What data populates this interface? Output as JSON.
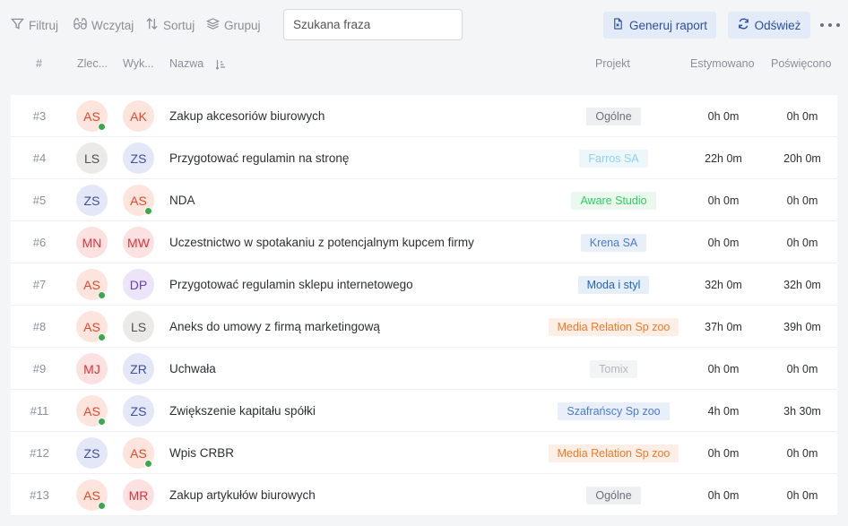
{
  "toolbar": {
    "filter_label": "Filtruj",
    "load_label": "Wczytaj",
    "sort_label": "Sortuj",
    "group_label": "Grupuj",
    "search_placeholder": "Szukana fraza",
    "report_label": "Generuj raport",
    "refresh_label": "Odśwież"
  },
  "header": {
    "num": "#",
    "ordering": "Zlec...",
    "executing": "Wyk...",
    "name": "Nazwa",
    "project": "Projekt",
    "estimated": "Estymowano",
    "spent": "Poświęcono"
  },
  "colors": {
    "online": "#3aa84b",
    "button_bg": "#e3ebf9",
    "button_text": "#2c4fa0"
  },
  "avatar_styles": {
    "AS": {
      "bg": "#fde5de",
      "fg": "#e0482a"
    },
    "AK": {
      "bg": "#fde5de",
      "fg": "#e0482a"
    },
    "LS": {
      "bg": "#eceae9",
      "fg": "#4c4f55"
    },
    "ZS": {
      "bg": "#e4e7f7",
      "fg": "#3e4da3"
    },
    "MN": {
      "bg": "#fde0e0",
      "fg": "#e0323a"
    },
    "MW": {
      "bg": "#fde0e0",
      "fg": "#e0323a"
    },
    "DP": {
      "bg": "#ece4f8",
      "fg": "#6a3fb3"
    },
    "MJ": {
      "bg": "#fde0e0",
      "fg": "#e0323a"
    },
    "ZR": {
      "bg": "#e4e7f7",
      "fg": "#3e4da3"
    },
    "MR": {
      "bg": "#fde0e0",
      "fg": "#e0323a"
    }
  },
  "rows": [
    {
      "num": "#3",
      "ordering": "AS",
      "ordering_online": true,
      "executing": "AK",
      "executing_online": false,
      "name": "Zakup akcesoriów biurowych",
      "project": "Ogólne",
      "project_bg": "#eeeff1",
      "project_fg": "#6b7079",
      "estimated": "0h 0m",
      "spent": "0h 0m"
    },
    {
      "num": "#4",
      "ordering": "LS",
      "ordering_online": false,
      "executing": "ZS",
      "executing_online": false,
      "name": "Przygotować regulamin na stronę",
      "project": "Farros SA",
      "project_bg": "#ecf6fb",
      "project_fg": "#8fd2ee",
      "estimated": "22h 0m",
      "spent": "20h 0m"
    },
    {
      "num": "#5",
      "ordering": "ZS",
      "ordering_online": false,
      "executing": "AS",
      "executing_online": true,
      "name": "NDA",
      "project": "Aware Studio",
      "project_bg": "#eaf8ee",
      "project_fg": "#2fcf66",
      "estimated": "0h 0m",
      "spent": "0h 0m"
    },
    {
      "num": "#6",
      "ordering": "MN",
      "ordering_online": false,
      "executing": "MW",
      "executing_online": false,
      "name": "Uczestnictwo w spotakaniu z potencjalnym kupcem firmy",
      "project": "Krena SA",
      "project_bg": "#e9eff9",
      "project_fg": "#4a7bd0",
      "estimated": "0h 0m",
      "spent": "0h 0m"
    },
    {
      "num": "#7",
      "ordering": "AS",
      "ordering_online": true,
      "executing": "DP",
      "executing_online": false,
      "name": "Przygotować regulamin sklepu internetowego",
      "project": "Moda i styl",
      "project_bg": "#e6eef8",
      "project_fg": "#1e63c2",
      "estimated": "32h 0m",
      "spent": "32h 0m"
    },
    {
      "num": "#8",
      "ordering": "AS",
      "ordering_online": true,
      "executing": "LS",
      "executing_online": false,
      "name": "Aneks do umowy z firmą marketingową",
      "project": "Media Relation Sp zoo",
      "project_bg": "#fdefe5",
      "project_fg": "#f07a2a",
      "estimated": "37h 0m",
      "spent": "39h 0m"
    },
    {
      "num": "#9",
      "ordering": "MJ",
      "ordering_online": false,
      "executing": "ZR",
      "executing_online": false,
      "name": "Uchwała",
      "project": "Tomix",
      "project_bg": "#f3f4f5",
      "project_fg": "#b5b8bd",
      "estimated": "0h 0m",
      "spent": "0h 0m"
    },
    {
      "num": "#11",
      "ordering": "AS",
      "ordering_online": true,
      "executing": "ZS",
      "executing_online": false,
      "name": "Zwiększenie kapitału spółki",
      "project": "Szafrańscy Sp zoo",
      "project_bg": "#e9eff9",
      "project_fg": "#4a7bd0",
      "estimated": "4h 0m",
      "spent": "3h 30m"
    },
    {
      "num": "#12",
      "ordering": "ZS",
      "ordering_online": false,
      "executing": "AS",
      "executing_online": true,
      "name": "Wpis CRBR",
      "project": "Media Relation Sp zoo",
      "project_bg": "#fdefe5",
      "project_fg": "#f07a2a",
      "estimated": "0h 0m",
      "spent": "0h 0m"
    },
    {
      "num": "#13",
      "ordering": "AS",
      "ordering_online": true,
      "executing": "MR",
      "executing_online": false,
      "name": "Zakup artykułów biurowych",
      "project": "Ogólne",
      "project_bg": "#eeeff1",
      "project_fg": "#6b7079",
      "estimated": "0h 0m",
      "spent": "0h 0m"
    }
  ]
}
